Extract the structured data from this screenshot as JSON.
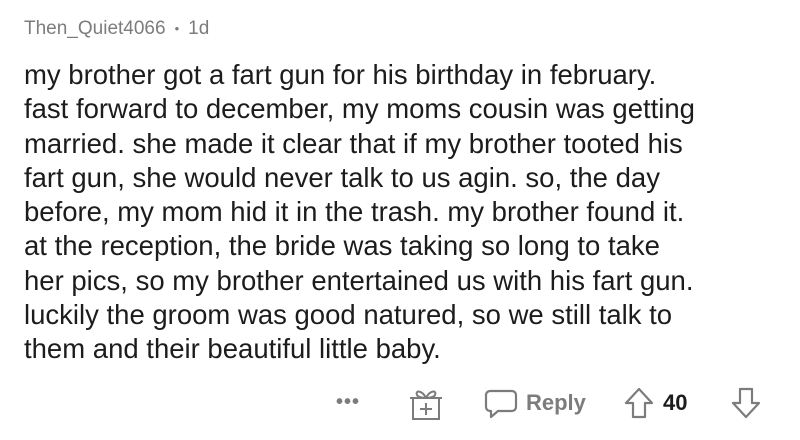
{
  "comment": {
    "author": "Then_Quiet4066",
    "separator": "•",
    "age": "1d",
    "body_lines": [
      "my brother got a fart gun for his birthday in february.",
      "fast forward to december, my moms cousin was getting",
      "married. she  made it clear that if my brother tooted his",
      "fart gun, she would never talk to us agin. so, the day",
      "before, my mom hid it in the trash. my brother found it.",
      "at the reception, the bride was taking so long to take",
      "her pics, so my brother entertained us with his fart gun.",
      "luckily the groom was good natured, so we still talk to",
      "them and their beautiful little baby."
    ]
  },
  "actions": {
    "more_label": "•••",
    "award_icon": "gift-icon",
    "reply_icon": "speech-bubble-icon",
    "reply_label": "Reply",
    "upvote_icon": "arrow-up-icon",
    "score": "40",
    "downvote_icon": "arrow-down-icon"
  },
  "colors": {
    "text": "#1c1c1c",
    "meta": "#7c7c7c",
    "background": "#ffffff"
  }
}
